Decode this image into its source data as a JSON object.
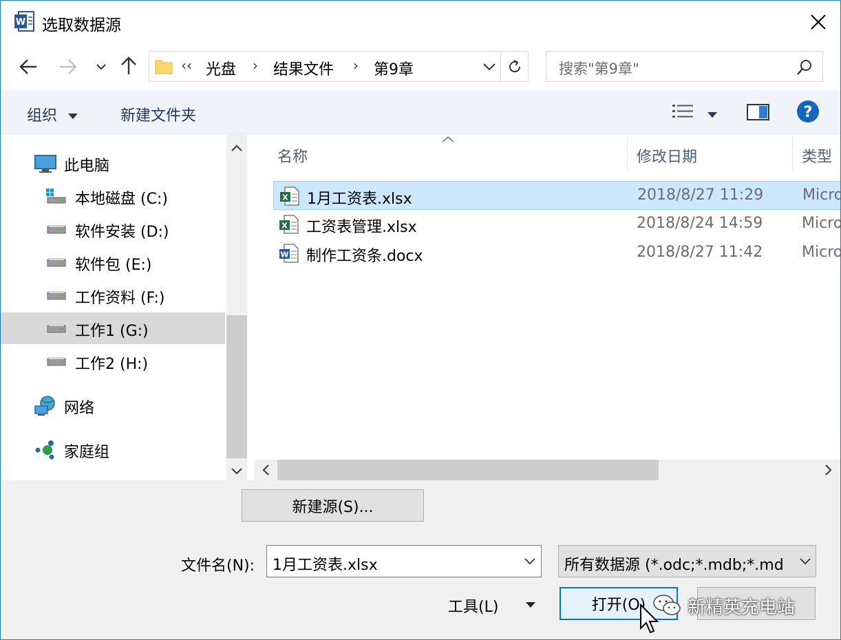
{
  "window": {
    "title": "选取数据源",
    "accent": "#1f78c8"
  },
  "address": {
    "overflow": "‹‹",
    "segments": [
      "光盘",
      "结果文件",
      "第9章"
    ],
    "search_placeholder": "搜索\"第9章\""
  },
  "toolbar": {
    "organize_label": "组织",
    "new_folder_label": "新建文件夹"
  },
  "nav": {
    "this_pc": "此电脑",
    "drives": [
      {
        "label": "本地磁盘 (C:)"
      },
      {
        "label": "软件安装 (D:)"
      },
      {
        "label": "软件包 (E:)"
      },
      {
        "label": "工作资料 (F:)"
      },
      {
        "label": "工作1 (G:)",
        "selected": true
      },
      {
        "label": "工作2 (H:)"
      }
    ],
    "network": "网络",
    "homegroup": "家庭组"
  },
  "files": {
    "columns": {
      "name": "名称",
      "date": "修改日期",
      "type": "类型"
    },
    "rows": [
      {
        "name": "1月工资表.xlsx",
        "date": "2018/8/27  11:29",
        "type": "Micro",
        "icon": "excel-file-icon",
        "selected": true
      },
      {
        "name": "工资表管理.xlsx",
        "date": "2018/8/24  14:59",
        "type": "Micro",
        "icon": "excel-file-icon"
      },
      {
        "name": "制作工资条.docx",
        "date": "2018/8/27  11:42",
        "type": "Micro",
        "icon": "word-file-icon"
      }
    ]
  },
  "bottom": {
    "new_source_label": "新建源(S)...",
    "filename_label": "文件名(N):",
    "filename_value": "1月工资表.xlsx",
    "filter_value": "所有数据源 (*.odc;*.mdb;*.md",
    "tools_label": "工具(L)",
    "open_label": "打开(O)"
  },
  "watermark": {
    "text": "新精英充电站"
  }
}
